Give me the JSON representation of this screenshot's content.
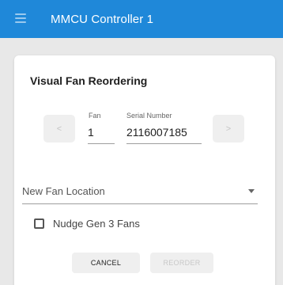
{
  "appbar": {
    "title": "MMCU Controller 1",
    "menu_icon": "hamburger-menu-icon"
  },
  "card": {
    "title": "Visual Fan Reordering",
    "prev_label": "<",
    "next_label": ">",
    "fan": {
      "label": "Fan",
      "value": "1"
    },
    "serial": {
      "label": "Serial Number",
      "value": "2116007185"
    },
    "new_location": {
      "label": "New Fan Location",
      "arrow_icon": "dropdown-arrow-icon"
    },
    "nudge": {
      "label": "Nudge Gen 3 Fans",
      "checked": false
    },
    "cancel_label": "CANCEL",
    "reorder_label": "REORDER"
  },
  "colors": {
    "appbar": "#1f88d9",
    "background": "#e8e8e8",
    "card": "#ffffff",
    "button": "#efefef"
  }
}
